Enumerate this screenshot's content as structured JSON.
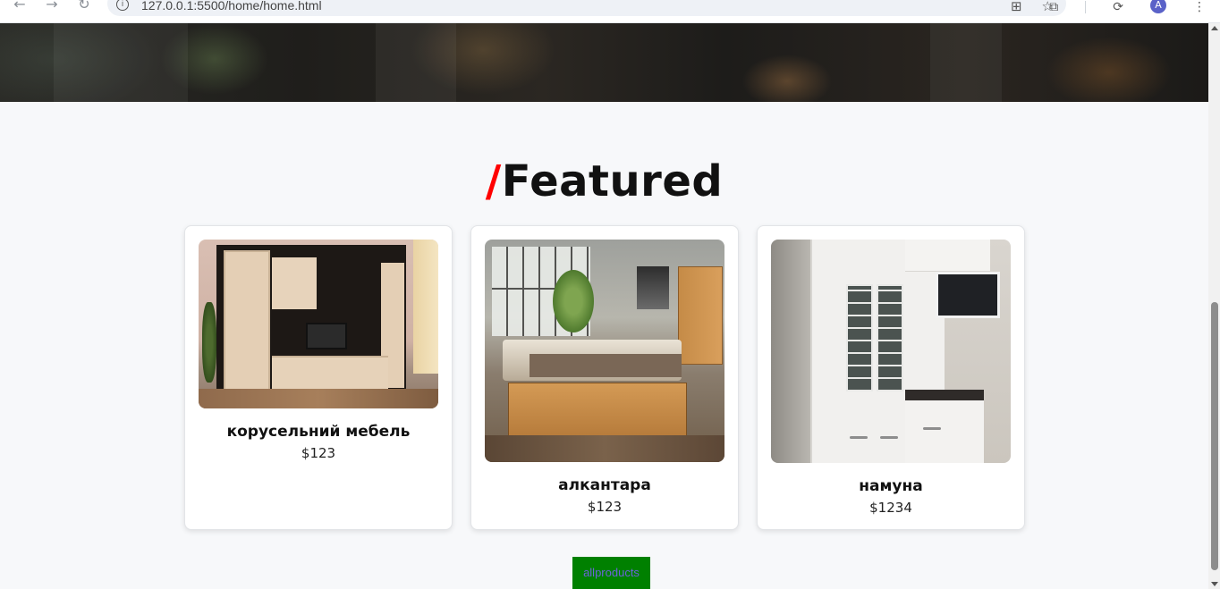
{
  "browser": {
    "url": "127.0.0.1:5500/home/home.html",
    "profile_initial": "A"
  },
  "heading": {
    "slash": "/",
    "title": "Featured",
    "slash_color": "#ff0000"
  },
  "products": [
    {
      "name": "корусельний мебель",
      "price": "$123",
      "image": "wall-unit-furniture"
    },
    {
      "name": "алкантара",
      "price": "$123",
      "image": "wooden-bedroom"
    },
    {
      "name": "намуна",
      "price": "$1234",
      "image": "white-kitchen-cabinets"
    }
  ],
  "all_products_button": {
    "label": "allproducts",
    "background": "#008000"
  }
}
